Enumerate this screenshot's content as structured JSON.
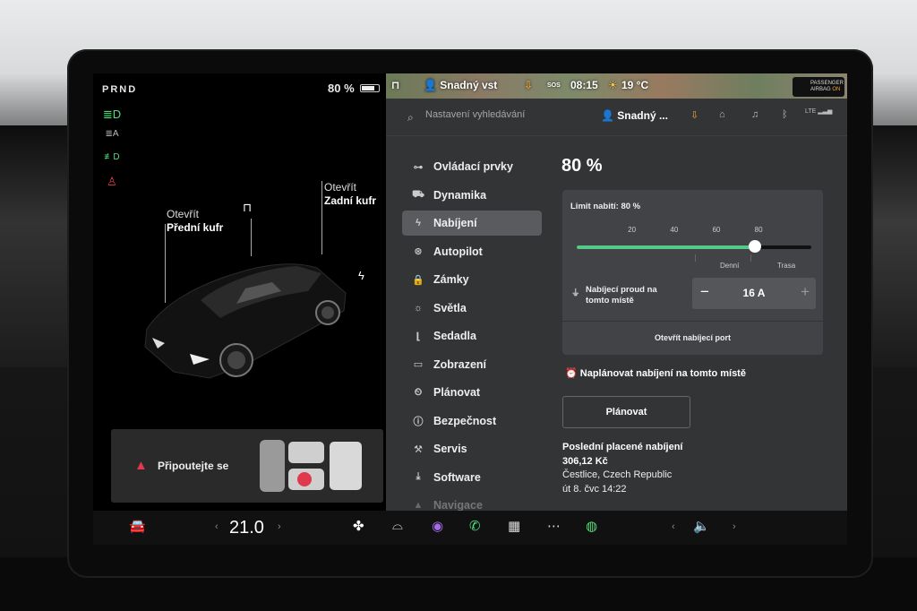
{
  "left_panel": {
    "gear": "PRND",
    "battery_percent": "80 %",
    "battery_level": 0.8,
    "front_trunk": {
      "line1": "Otevřít",
      "line2": "Přední kufr"
    },
    "rear_trunk": {
      "line1": "Otevřít",
      "line2": "Zadní kufr"
    },
    "seatbelt_warning": "Připoutejte se"
  },
  "top_strip": {
    "profile_name": "Snadný vst",
    "time": "08:15",
    "temperature": "19 °C",
    "sos": "SOS",
    "airbag_line1": "PASSENGER",
    "airbag_line2": "AIRBAG",
    "airbag_state": "ON"
  },
  "header": {
    "search_placeholder": "Nastavení vyhledávání",
    "profile": "Snadný ...",
    "lte": "LTE"
  },
  "menu": {
    "items": [
      {
        "label": "Ovládací prvky",
        "icon": "toggle-icon"
      },
      {
        "label": "Dynamika",
        "icon": "car-icon"
      },
      {
        "label": "Nabíjení",
        "icon": "bolt-icon",
        "active": true
      },
      {
        "label": "Autopilot",
        "icon": "steering-wheel-icon"
      },
      {
        "label": "Zámky",
        "icon": "lock-icon"
      },
      {
        "label": "Světla",
        "icon": "sun-icon"
      },
      {
        "label": "Sedadla",
        "icon": "seat-icon"
      },
      {
        "label": "Zobrazení",
        "icon": "display-icon"
      },
      {
        "label": "Plánovat",
        "icon": "alarm-icon"
      },
      {
        "label": "Bezpečnost",
        "icon": "info-icon"
      },
      {
        "label": "Servis",
        "icon": "wrench-icon"
      },
      {
        "label": "Software",
        "icon": "download-icon"
      },
      {
        "label": "Navigace",
        "icon": "nav-icon"
      }
    ]
  },
  "charging": {
    "percent_title": "80 %",
    "limit_label": "Limit nabití: 80 %",
    "limit_value": 80,
    "ticks": [
      "20",
      "40",
      "60",
      "80"
    ],
    "zone_daily": "Denní",
    "zone_trip": "Trasa",
    "current_label_line1": "Nabíjecí proud na",
    "current_label_line2": "tomto místě",
    "current_value": "16 A",
    "minus": "−",
    "plus": "+",
    "open_port": "Otevřít nabíjecí port",
    "schedule_title": "Naplánovat nabíjení na tomto místě",
    "schedule_button": "Plánovat",
    "last_title": "Poslední placené nabíjení",
    "last_price": "306,12 Kč",
    "last_location": "Čestlice, Czech Republic",
    "last_date": "út 8. čvc 14:22"
  },
  "bottom_bar": {
    "temperature": "21.0",
    "chev_left": "‹",
    "chev_right": "›"
  }
}
